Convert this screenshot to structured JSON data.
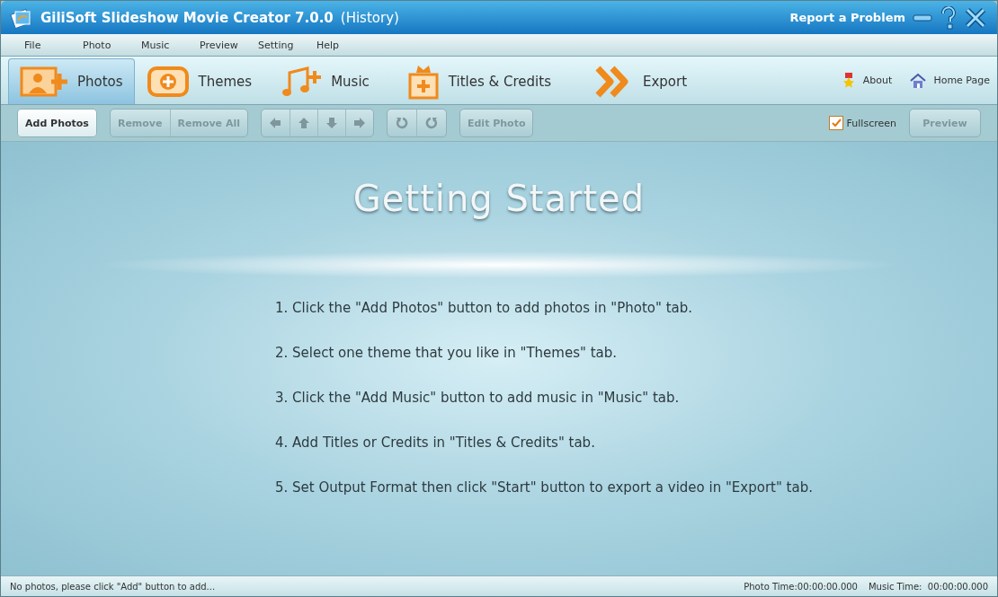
{
  "window": {
    "title": "GiliSoft Slideshow Movie Creator 7.0.0",
    "subtitle": "(History)",
    "report_link": "Report a Problem"
  },
  "menu": [
    "File",
    "Photo",
    "Music",
    "Preview",
    "Setting",
    "Help"
  ],
  "tabs": [
    {
      "label": "Photos",
      "kind": "photos",
      "selected": true
    },
    {
      "label": "Themes",
      "kind": "themes",
      "selected": false
    },
    {
      "label": "Music",
      "kind": "music",
      "selected": false
    },
    {
      "label": "Titles & Credits",
      "kind": "titles",
      "selected": false
    },
    {
      "label": "Export",
      "kind": "export",
      "selected": false
    }
  ],
  "links": [
    {
      "label": "About",
      "kind": "about"
    },
    {
      "label": "Home Page",
      "kind": "home"
    }
  ],
  "toolbar": {
    "groups": [
      [
        {
          "kind": "text",
          "label": "Add Photos",
          "disabled": false
        }
      ],
      [
        {
          "kind": "text",
          "label": "Remove",
          "disabled": true
        },
        {
          "kind": "text",
          "label": "Remove All",
          "disabled": true
        }
      ],
      [
        {
          "kind": "left",
          "disabled": true
        },
        {
          "kind": "up",
          "disabled": true
        },
        {
          "kind": "down",
          "disabled": true
        },
        {
          "kind": "right",
          "disabled": true
        }
      ],
      [
        {
          "kind": "rotate-left",
          "disabled": true
        },
        {
          "kind": "rotate-right",
          "disabled": true
        }
      ],
      [
        {
          "kind": "text",
          "label": "Edit Photo",
          "disabled": true
        }
      ]
    ],
    "fullscreen": {
      "label": "Fullscreen",
      "checked": true
    },
    "preview": {
      "label": "Preview",
      "disabled": true
    }
  },
  "main": {
    "heading": "Getting Started",
    "steps": [
      "1. Click the \"Add Photos\" button to add photos in \"Photo\" tab.",
      "2. Select one theme that you like in \"Themes\" tab.",
      "3. Click the \"Add Music\" button to add music in \"Music\" tab.",
      "4. Add Titles or Credits in \"Titles & Credits\" tab.",
      "5. Set Output Format then click \"Start\" button to export a video in \"Export\" tab."
    ]
  },
  "status_bar": {
    "message": "No photos, please click \"Add\" button to add...",
    "photo_time": "Photo Time:00:00:00.000",
    "music_time": "Music Time:  00:00:00.000"
  }
}
